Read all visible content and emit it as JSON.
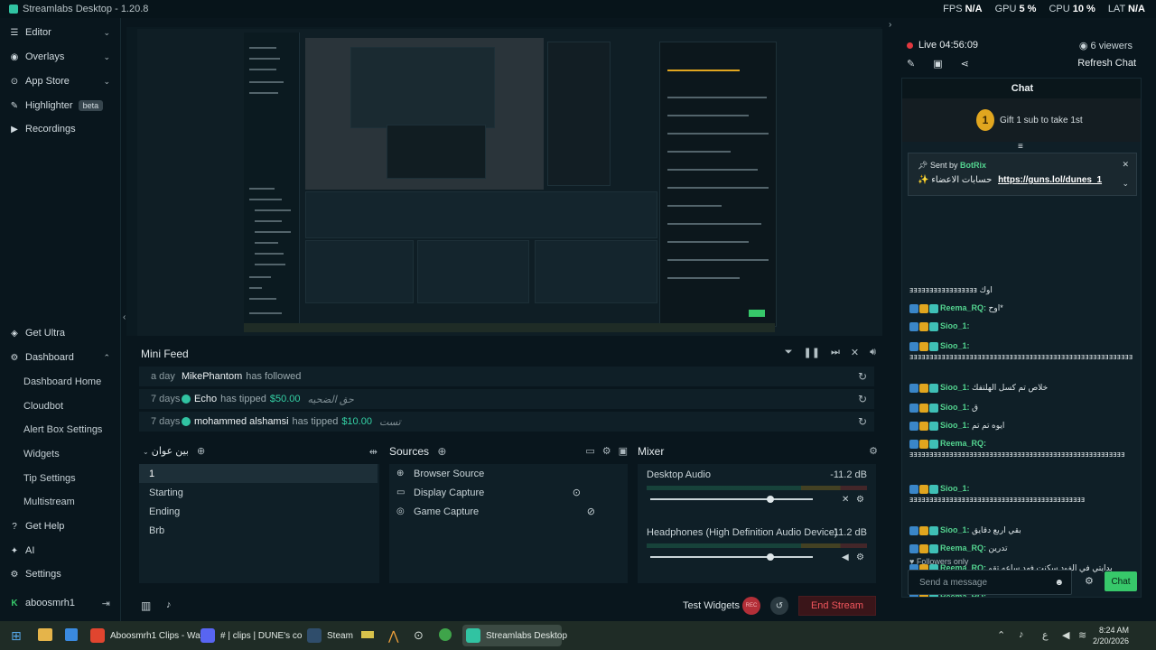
{
  "window": {
    "title": "Streamlabs Desktop - 1.20.8",
    "stats": [
      {
        "label": "FPS",
        "value": "N/A"
      },
      {
        "label": "GPU",
        "value": "5 %"
      },
      {
        "label": "CPU",
        "value": "10 %"
      },
      {
        "label": "LAT",
        "value": "N/A"
      }
    ]
  },
  "sidebar": {
    "top": [
      {
        "label": "Editor",
        "icon": "sliders-icon"
      },
      {
        "label": "Overlays",
        "icon": "overlay-icon"
      },
      {
        "label": "App Store",
        "icon": "store-icon"
      },
      {
        "label": "Highlighter",
        "icon": "highlighter-icon",
        "badge": "beta"
      },
      {
        "label": "Recordings",
        "icon": "record-icon"
      }
    ],
    "bottom": [
      {
        "label": "Get Ultra"
      },
      {
        "label": "Dashboard"
      },
      {
        "label": "Dashboard Home"
      },
      {
        "label": "Cloudbot"
      },
      {
        "label": "Alert Box Settings"
      },
      {
        "label": "Widgets"
      },
      {
        "label": "Tip Settings"
      },
      {
        "label": "Multistream"
      },
      {
        "label": "Get Help"
      },
      {
        "label": "AI"
      },
      {
        "label": "Settings"
      }
    ],
    "user": "aboosmrh1"
  },
  "mini_feed": {
    "title": "Mini Feed",
    "rows": [
      {
        "ago": "a day",
        "user": "MikePhantom",
        "action": "has followed",
        "amount": "",
        "note": ""
      },
      {
        "ago": "7 days",
        "user": "Echo",
        "action": "has tipped",
        "amount": "$50.00",
        "note": "حق الضحيه"
      },
      {
        "ago": "7 days",
        "user": "mohammed alshamsi",
        "action": "has tipped",
        "amount": "$10.00",
        "note": "تست"
      }
    ]
  },
  "scenes": {
    "title": "بين عوان",
    "items": [
      "1",
      "Starting",
      "Ending",
      "Brb"
    ],
    "selected": "1"
  },
  "sources": {
    "title": "Sources",
    "items": [
      "Browser Source",
      "Display Capture",
      "Game Capture"
    ]
  },
  "mixer": {
    "title": "Mixer",
    "channels": [
      {
        "name": "Desktop Audio",
        "db": "-11.2 dB",
        "level": 0.74
      },
      {
        "name": "Headphones (High Definition Audio Device)",
        "db": "-11.2 dB",
        "level": 0.74
      }
    ]
  },
  "footer": {
    "test_widgets": "Test Widgets",
    "rec": "REC",
    "end_stream": "End Stream"
  },
  "right": {
    "live": "Live 04:56:09",
    "viewers": "6 viewers",
    "refresh": "Refresh Chat",
    "chat_title": "Chat",
    "gift": "Gift 1 sub to take 1st",
    "gift_number": "1",
    "pinned_by": "Sent by",
    "pinned_user": "BotRix",
    "pinned_text": "✨ حسابات الاعضاء",
    "pinned_link": "https://guns.lol/dunes_1",
    "messages": [
      {
        "user": "",
        "text": "ⱻⱻⱻⱻⱻⱻⱻⱻⱻⱻⱻⱻⱻⱻⱻⱻⱻ اوك"
      },
      {
        "user": "Reema_RQ:",
        "text": "اوح*"
      },
      {
        "user": "Sioo_1:",
        "text": ""
      },
      {
        "user": "Sioo_1:",
        "text": "ⱻⱻⱻⱻⱻⱻⱻⱻⱻⱻⱻⱻⱻⱻⱻⱻⱻⱻⱻⱻⱻⱻⱻⱻⱻⱻⱻⱻⱻⱻⱻⱻⱻⱻⱻⱻⱻⱻⱻⱻⱻⱻⱻⱻⱻⱻⱻⱻⱻⱻⱻⱻⱻⱻⱻⱻ"
      },
      {
        "user": "Sioo_1:",
        "text": "خلاص تم كسل الهلتفك"
      },
      {
        "user": "Sioo_1:",
        "text": "ق"
      },
      {
        "user": "Sioo_1:",
        "text": "ايوه تم تم"
      },
      {
        "user": "Reema_RQ:",
        "text": "ⱻⱻⱻⱻⱻⱻⱻⱻⱻⱻⱻⱻⱻⱻⱻⱻⱻⱻⱻⱻⱻⱻⱻⱻⱻⱻⱻⱻⱻⱻⱻⱻⱻⱻⱻⱻⱻⱻⱻⱻⱻⱻⱻⱻⱻⱻⱻⱻⱻⱻⱻⱻⱻⱻ"
      },
      {
        "user": "Sioo_1:",
        "text": "ⱻⱻⱻⱻⱻⱻⱻⱻⱻⱻⱻⱻⱻⱻⱻⱻⱻⱻⱻⱻⱻⱻⱻⱻⱻⱻⱻⱻⱻⱻⱻⱻⱻⱻⱻⱻⱻⱻⱻⱻⱻⱻⱻⱻ"
      },
      {
        "user": "Sioo_1:",
        "text": "بقي اربع دقايق"
      },
      {
        "user": "Reema_RQ:",
        "text": "تدرين"
      },
      {
        "user": "Reema_RQ:",
        "text": "بدايتي في الفود سكنت فهد ساعه تقو ماعرفت اكله"
      },
      {
        "user": "Reema_RQ:",
        "text": "ⱻⱻⱻⱻⱻⱻⱻⱻⱻⱻⱻⱻⱻⱻⱻⱻⱻⱻⱻⱻⱻⱻⱻⱻⱻⱻⱻⱻⱻⱻⱻⱻⱻⱻⱻⱻⱻⱻⱻⱻ وسوه"
      }
    ],
    "followers_only": "Followers only",
    "input_placeholder": "Send a message",
    "chat_button": "Chat"
  },
  "taskbar": {
    "items": [
      {
        "label": "Aboosmrh1 Clips - Watc",
        "color": "#e0452f"
      },
      {
        "label": "# | clips | DUNE's co",
        "color": "#5865f2"
      },
      {
        "label": "Steam",
        "color": "#1b2838"
      },
      {
        "label": "Streamlabs Desktop",
        "color": "#31c3a2"
      }
    ],
    "time": "8:24 AM",
    "date": "2/20/2026"
  }
}
